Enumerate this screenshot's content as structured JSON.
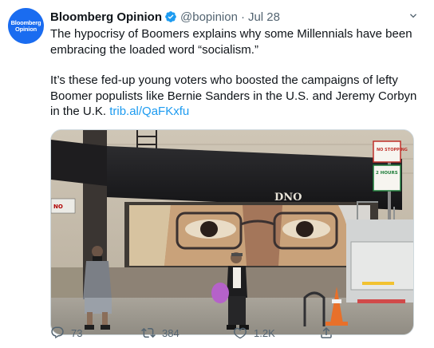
{
  "tweet": {
    "avatar_text_1": "Bloomberg",
    "avatar_text_2": "Opinion",
    "author_name": "Bloomberg Opinion",
    "handle": "@bopinion",
    "separator": "·",
    "date": "Jul 28",
    "text_p1": "The hypocrisy of Boomers explains why some Millennials have been embracing the loaded word “socialism.”",
    "text_p2": "It’s these fed-up young voters who boosted the campaigns of lefty Boomer populists like Bernie Sanders in the U.S. and Jeremy Corbyn in the U.K. ",
    "link": "trib.al/QaFKxfu"
  },
  "media": {
    "storefront_sign": "DNO",
    "no_sign_text": "NO",
    "parking_sign_top": "NO STOPPING",
    "parking_sign_mid": "2 HOURS"
  },
  "actions": {
    "reply_count": "73",
    "retweet_count": "384",
    "like_count": "1.2K"
  },
  "colors": {
    "accent": "#1d9bf0",
    "avatar_bg": "#1a6cf0"
  }
}
